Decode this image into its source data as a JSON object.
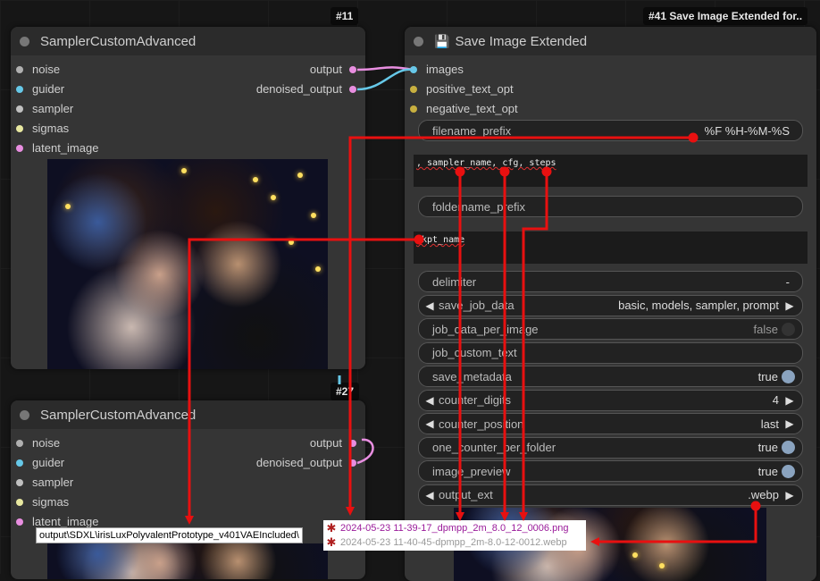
{
  "node11": {
    "badge": "#11",
    "title": "SamplerCustomAdvanced",
    "inputs": [
      {
        "label": "noise",
        "color": "#b0b0b0"
      },
      {
        "label": "guider",
        "color": "#66c8e8"
      },
      {
        "label": "sampler",
        "color": "#c0c0c0"
      },
      {
        "label": "sigmas",
        "color": "#e8e8a0"
      },
      {
        "label": "latent_image",
        "color": "#e88ee0"
      }
    ],
    "outputs": [
      {
        "label": "output",
        "color": "#e88ee0"
      },
      {
        "label": "denoised_output",
        "color": "#e88ee0"
      }
    ]
  },
  "node27": {
    "badge": "#27",
    "title": "SamplerCustomAdvanced",
    "inputs": [
      {
        "label": "noise",
        "color": "#b0b0b0"
      },
      {
        "label": "guider",
        "color": "#66c8e8"
      },
      {
        "label": "sampler",
        "color": "#c0c0c0"
      },
      {
        "label": "sigmas",
        "color": "#e8e8a0"
      },
      {
        "label": "latent_image",
        "color": "#e88ee0"
      }
    ],
    "outputs": [
      {
        "label": "output",
        "color": "#e88ee0"
      },
      {
        "label": "denoised_output",
        "color": "#e88ee0"
      }
    ]
  },
  "node41": {
    "badge": "#41 Save Image Extended for..",
    "title": "Save Image Extended",
    "title_icon": "floppy-disk-icon",
    "inputs": [
      {
        "label": "images",
        "color": "#66c8e8"
      },
      {
        "label": "positive_text_opt",
        "color": "#c8b040"
      },
      {
        "label": "negative_text_opt",
        "color": "#c8b040"
      }
    ],
    "filename_prefix": {
      "label": "filename_prefix",
      "value": "%F %H-%M-%S"
    },
    "filename_keys_text": ", sampler_name, cfg, steps",
    "foldername_prefix": {
      "label": "foldername_prefix"
    },
    "foldername_keys_text": "ckpt_name",
    "widgets": [
      {
        "type": "text",
        "label": "delimiter",
        "value": "-"
      },
      {
        "type": "combo",
        "label": "save_job_data",
        "value": "basic, models, sampler, prompt"
      },
      {
        "type": "toggle",
        "label": "job_data_per_image",
        "value": "false",
        "on": false
      },
      {
        "type": "text",
        "label": "job_custom_text",
        "value": ""
      },
      {
        "type": "toggle",
        "label": "save_metadata",
        "value": "true",
        "on": true
      },
      {
        "type": "combo",
        "label": "counter_digits",
        "value": "4"
      },
      {
        "type": "combo",
        "label": "counter_position",
        "value": "last"
      },
      {
        "type": "toggle",
        "label": "one_counter_per_folder",
        "value": "true",
        "on": true
      },
      {
        "type": "toggle",
        "label": "image_preview",
        "value": "true",
        "on": true
      },
      {
        "type": "combo",
        "label": "output_ext",
        "value": ".webp"
      }
    ]
  },
  "tooltip_path": "output\\SDXL\\irisLuxPolyvalentPrototype_v401VAEIncluded\\",
  "files": [
    {
      "name": "2024-05-23 11-39-17_dpmpp_2m_8.0_12_0006.png",
      "color": "#9a1a9a"
    },
    {
      "name": "2024-05-23 11-40-45-dpmpp_2m-8.0-12-0012.webp",
      "color": "#999999"
    }
  ],
  "annotation_color": "#e81010"
}
